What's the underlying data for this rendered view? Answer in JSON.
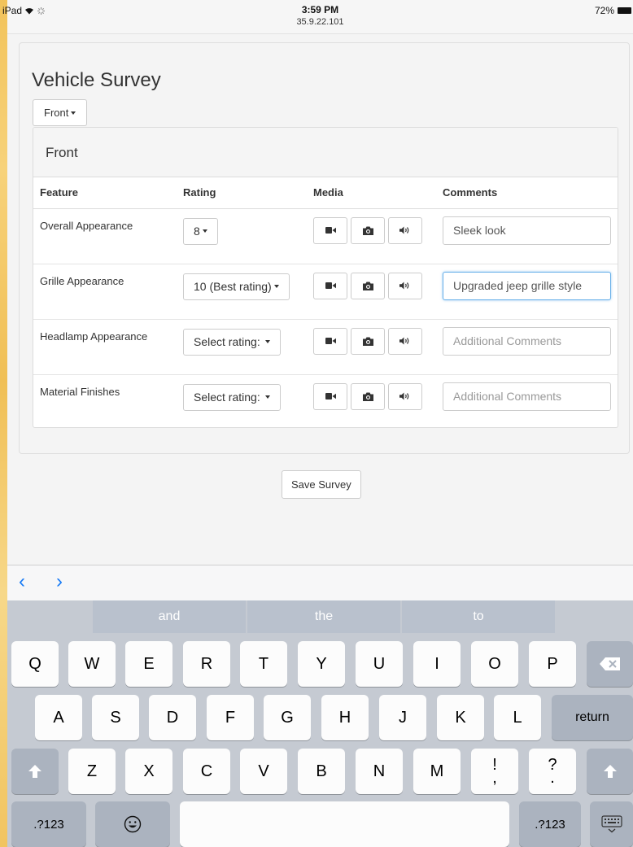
{
  "status_bar": {
    "device": "iPad",
    "time": "3:59 PM",
    "url": "35.9.22.101",
    "battery": "72%"
  },
  "survey": {
    "title": "Vehicle Survey",
    "section_select": "Front",
    "section_title": "Front",
    "columns": [
      "Feature",
      "Rating",
      "Media",
      "Comments"
    ],
    "rows": [
      {
        "feature": "Overall Appearance",
        "rating": "8",
        "comment": "Sleek look",
        "placeholder": "Additional Comments"
      },
      {
        "feature": "Grille Appearance",
        "rating": "10 (Best rating)",
        "comment": "Upgraded jeep grille style",
        "placeholder": "Additional Comments"
      },
      {
        "feature": "Headlamp Appearance",
        "rating": "Select rating:",
        "comment": "",
        "placeholder": "Additional Comments"
      },
      {
        "feature": "Material Finishes",
        "rating": "Select rating:",
        "comment": "",
        "placeholder": "Additional Comments"
      }
    ],
    "media_icons": [
      "video-camera-icon",
      "camera-icon",
      "speaker-icon"
    ],
    "save_label": "Save Survey"
  },
  "keyboard": {
    "suggestions": [
      "and",
      "the",
      "to"
    ],
    "row1": [
      "Q",
      "W",
      "E",
      "R",
      "T",
      "Y",
      "U",
      "I",
      "O",
      "P"
    ],
    "row2": [
      "A",
      "S",
      "D",
      "F",
      "G",
      "H",
      "J",
      "K",
      "L"
    ],
    "row3": [
      "Z",
      "X",
      "C",
      "V",
      "B",
      "N",
      "M"
    ],
    "punct1_top": "!",
    "punct1_bottom": ",",
    "punct2_top": "?",
    "punct2_bottom": ".",
    "return_label": "return",
    "numbers_label": ".?123"
  },
  "colors": {
    "accent": "#1a7cf5",
    "focus": "#66afe9"
  }
}
